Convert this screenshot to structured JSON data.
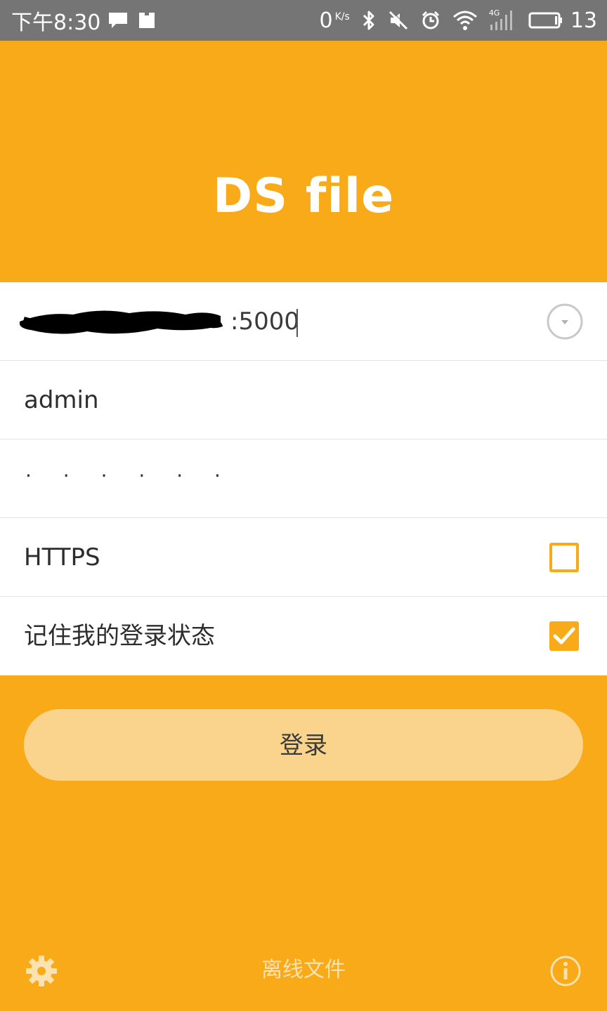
{
  "status_bar": {
    "time": "下午8:30",
    "speed": "0",
    "speed_unit": "K/s",
    "signal_label": "4G",
    "battery_pct": "13"
  },
  "app": {
    "title": "DS file"
  },
  "form": {
    "server_visible_value": ":5000",
    "username_value": "admin",
    "password_masked": "· · · · · ·",
    "https_label": "HTTPS",
    "https_checked": false,
    "remember_label": "记住我的登录状态",
    "remember_checked": true
  },
  "login_button_label": "登录",
  "bottom": {
    "offline_label": "离线文件"
  },
  "colors": {
    "accent": "#F9AA19",
    "button_fill": "#FAD48C",
    "status_bar": "#757575"
  }
}
